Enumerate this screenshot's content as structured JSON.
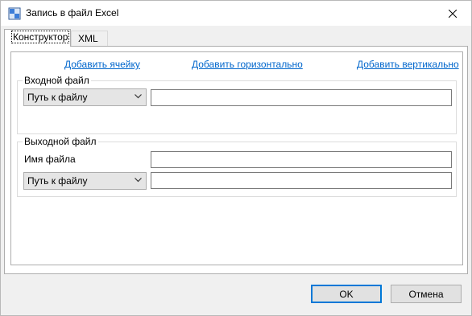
{
  "window": {
    "title": "Запись в файл Excel"
  },
  "tabs": [
    {
      "label": "Конструктор",
      "active": true
    },
    {
      "label": "XML",
      "active": false
    }
  ],
  "links": {
    "add_cell": "Добавить ячейку",
    "add_horizontal": "Добавить горизонтально",
    "add_vertical": "Добавить вертикально"
  },
  "input_group": {
    "title": "Входной файл",
    "path_type": "Путь к файлу",
    "path_value": ""
  },
  "output_group": {
    "title": "Выходной файл",
    "filename_label": "Имя файла",
    "filename_value": "",
    "path_type": "Путь к файлу",
    "path_value": ""
  },
  "buttons": {
    "ok": "OK",
    "cancel": "Отмена"
  },
  "colors": {
    "link": "#0066cc",
    "accent": "#0078d7"
  }
}
